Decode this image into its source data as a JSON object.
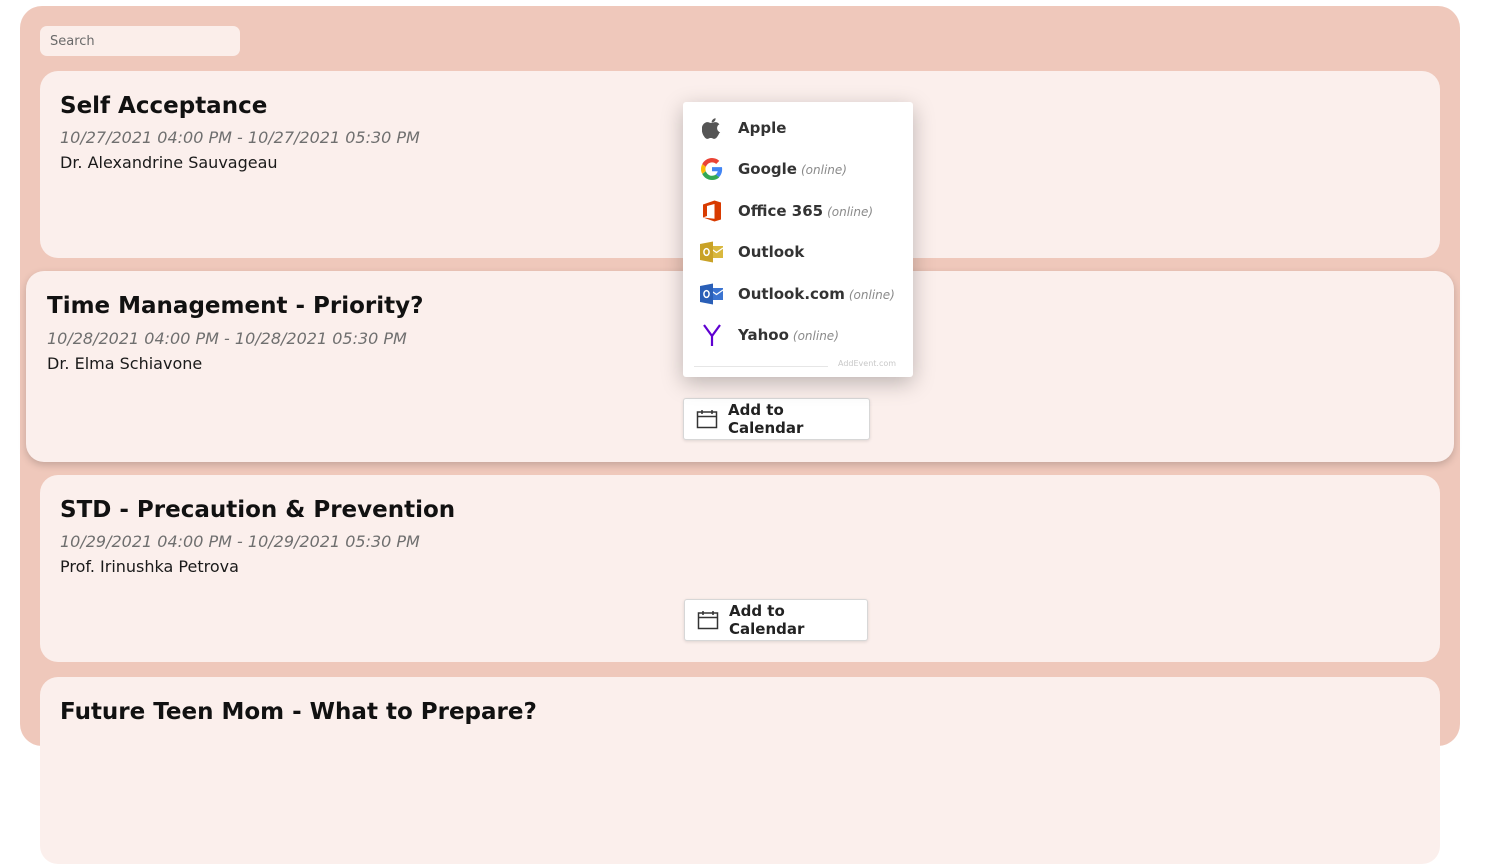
{
  "search": {
    "placeholder": "Search"
  },
  "events": [
    {
      "title": "Self Acceptance",
      "dates": "10/27/2021 04:00 PM - 10/27/2021 05:30 PM",
      "presenter": "Dr. Alexandrine Sauvageau"
    },
    {
      "title": "Time Management - Priority?",
      "dates": "10/28/2021 04:00 PM - 10/28/2021 05:30 PM",
      "presenter": "Dr. Elma Schiavone",
      "button_label": "Add to Calendar"
    },
    {
      "title": "STD - Precaution & Prevention",
      "dates": "10/29/2021 04:00 PM - 10/29/2021 05:30 PM",
      "presenter": "Prof. Irinushka Petrova",
      "button_label": "Add to Calendar"
    },
    {
      "title": "Future Teen Mom - What to Prepare?"
    }
  ],
  "calendar_menu": {
    "items": [
      {
        "label": "Apple",
        "icon": "apple-icon"
      },
      {
        "label": "Google",
        "note": "(online)",
        "icon": "google-icon"
      },
      {
        "label": "Office 365",
        "note": "(online)",
        "icon": "office365-icon"
      },
      {
        "label": "Outlook",
        "icon": "outlook-icon"
      },
      {
        "label": "Outlook.com",
        "note": "(online)",
        "icon": "outlookcom-icon"
      },
      {
        "label": "Yahoo",
        "note": "(online)",
        "icon": "yahoo-icon"
      }
    ],
    "footer": "AddEvent.com"
  },
  "colors": {
    "page_frame": "#efc8bb",
    "card": "#fbefec",
    "office_red": "#d83b01",
    "outlook_gold": "#c9a227",
    "outlookcom_blue": "#2a5fb7",
    "yahoo_purple": "#5f01d1"
  }
}
